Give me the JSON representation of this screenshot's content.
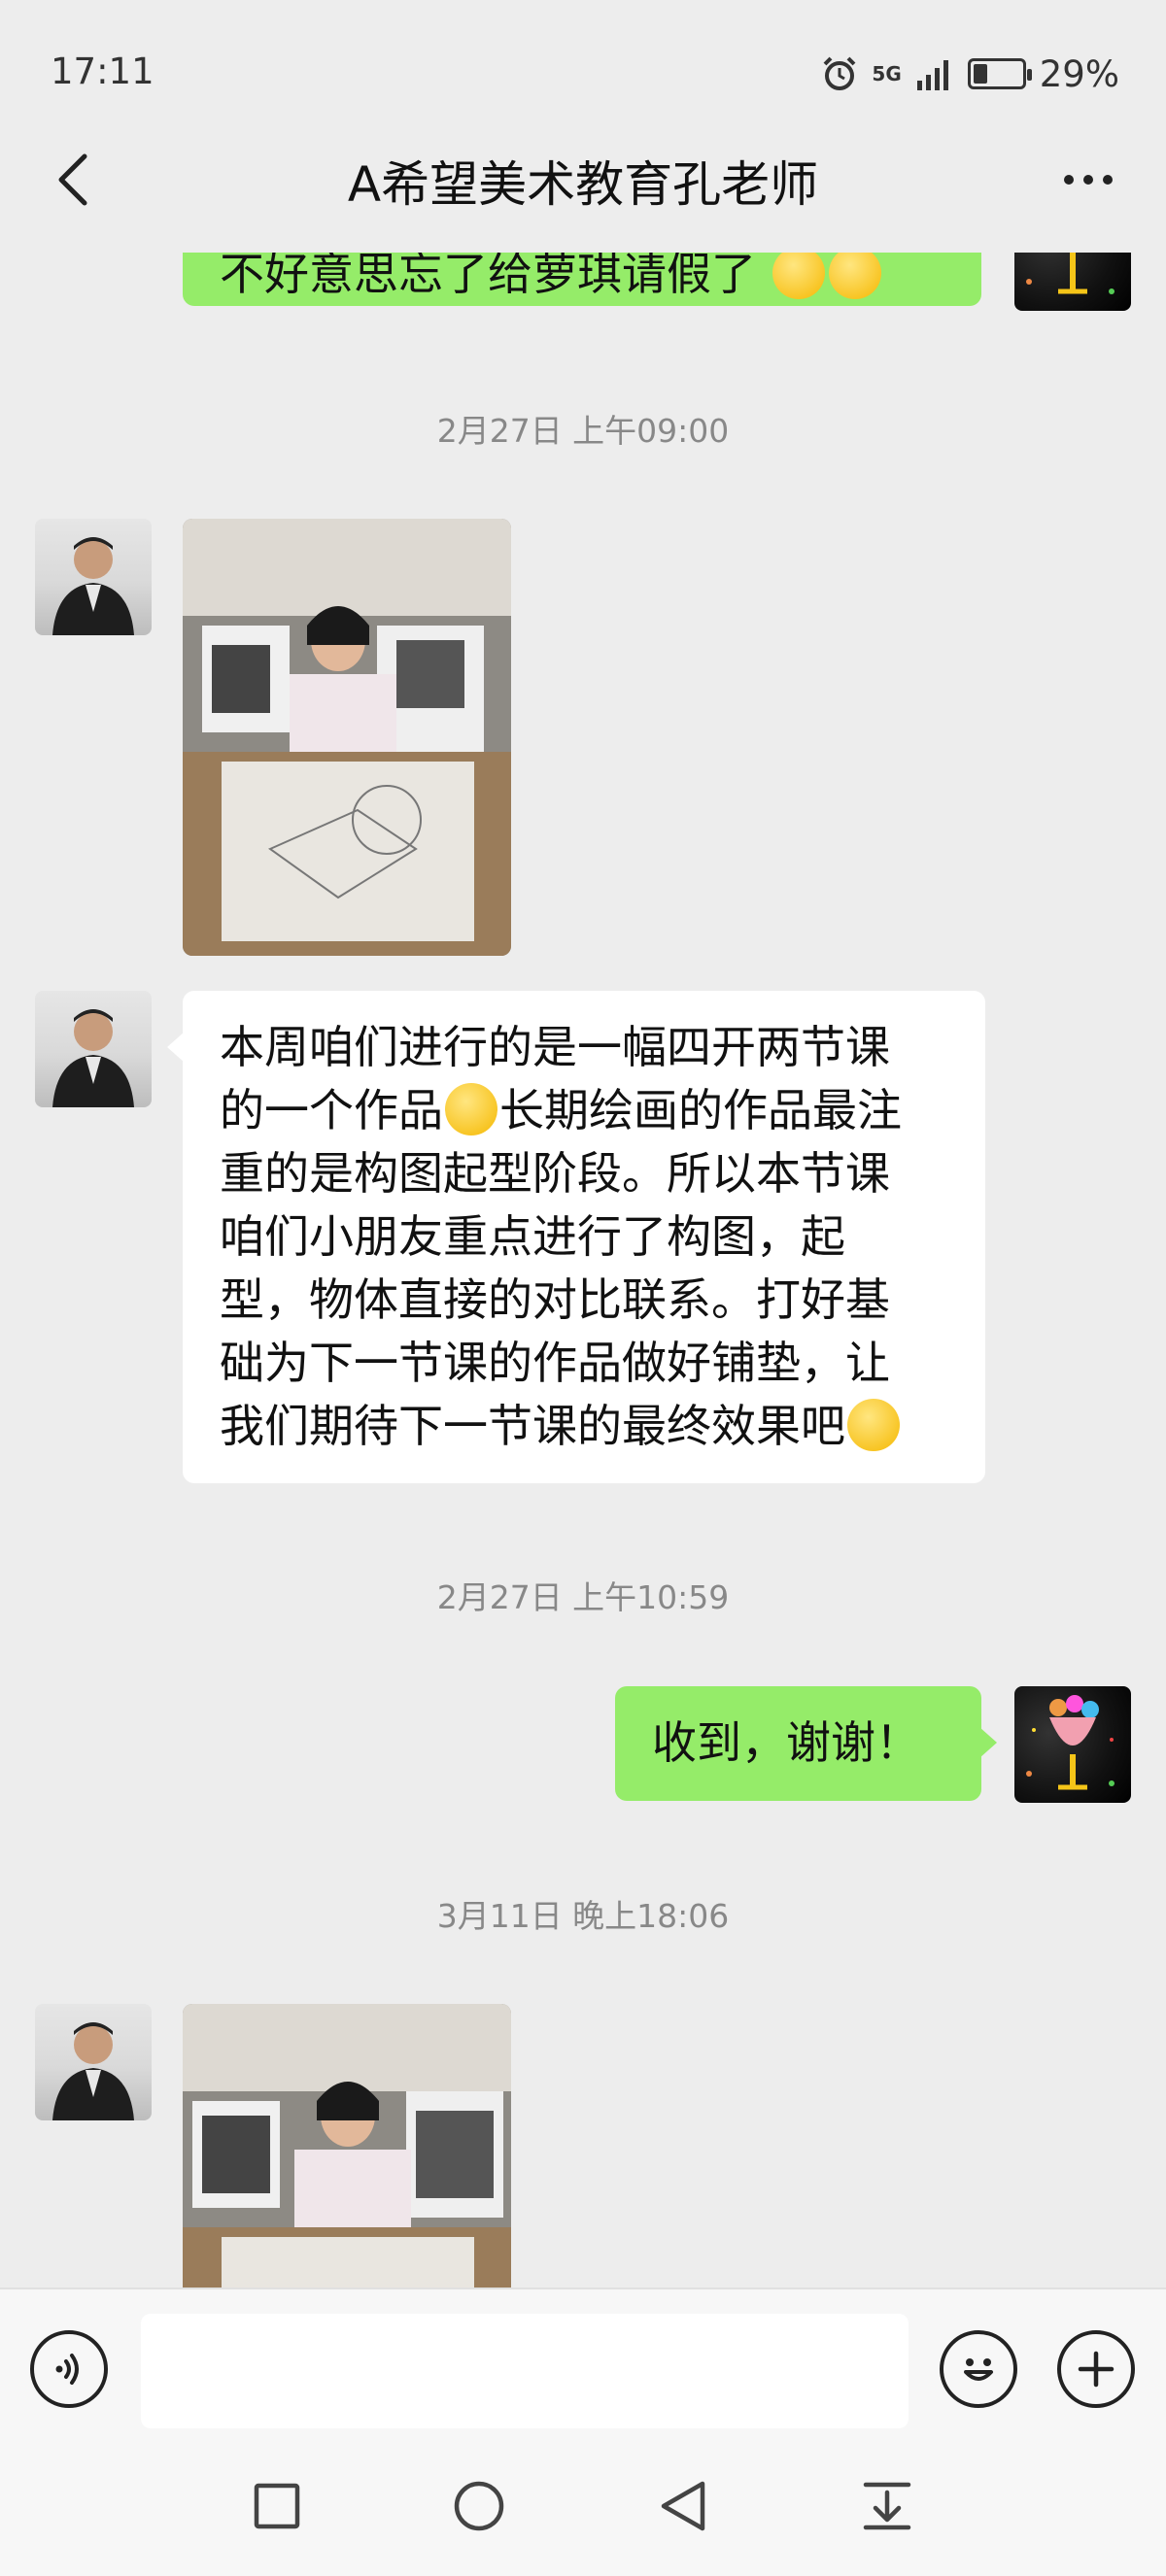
{
  "status_bar": {
    "time": "17:11",
    "network": "5G",
    "battery": "29%"
  },
  "header": {
    "title": "A希望美术教育孔老师"
  },
  "messages": {
    "partial_top": {
      "text": "不好意思忘了给萝琪请假了"
    },
    "ts1": "2月27日 上午09:00",
    "ts2": "2月27日 上午10:59",
    "ts3": "3月11日 晚上18:06",
    "teacher_text_lines": [
      "本周咱们进行的是一幅四开两节课",
      "的一个作品",
      "长期绘画的作品最注",
      "重的是构图起型阶段。所以本节课",
      "咱们小朋友重点进行了构图，起",
      "型，物体直接的对比联系。打好基",
      "础为下一节课的作品做好铺垫，让",
      "我们期待下一节课的最终效果吧"
    ],
    "reply": "收到，谢谢！"
  },
  "icons": {
    "back": "chevron-left-icon",
    "more": "more-dots-icon",
    "voice": "voice-icon",
    "emoji": "emoji-icon",
    "add": "add-icon"
  },
  "colors": {
    "background": "#ededed",
    "green_bubble": "#95ec69",
    "white_bubble": "#ffffff"
  }
}
